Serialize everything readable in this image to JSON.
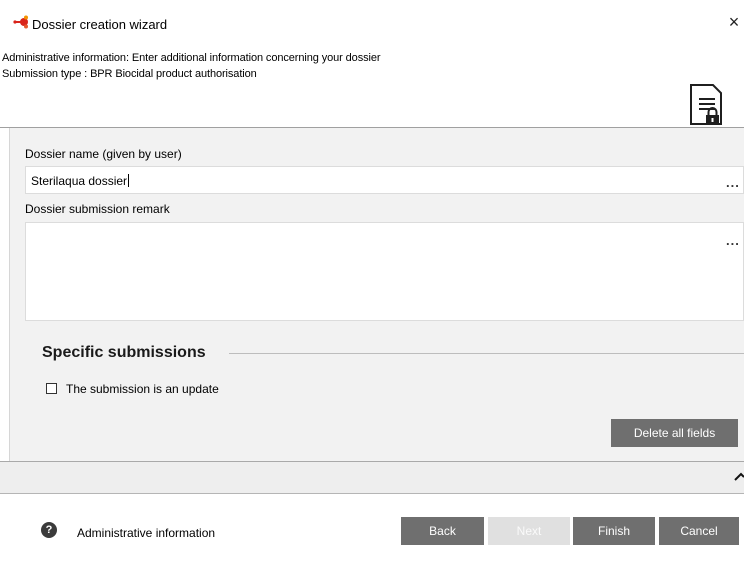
{
  "window": {
    "title": "Dossier creation wizard",
    "close_glyph": "×",
    "icon": "wizard-app-icon"
  },
  "header": {
    "line1": "Administrative information: Enter additional information concerning your dossier",
    "line2": "Submission type : BPR Biocidal product authorisation",
    "icon": "document-lock-icon"
  },
  "form": {
    "dossier_name_label": "Dossier name (given by user)",
    "dossier_name_value": "Sterilaqua dossier",
    "more_glyph": "...",
    "remark_label": "Dossier submission remark",
    "remark_value": ""
  },
  "specific": {
    "title": "Specific submissions",
    "update_checkbox_label": "The submission is an update",
    "update_checked": false,
    "delete_button": "Delete all fields"
  },
  "footer": {
    "help_glyph": "?",
    "step_label": "Administrative information",
    "buttons": {
      "back": "Back",
      "next": "Next",
      "finish": "Finish",
      "cancel": "Cancel"
    }
  },
  "colors": {
    "button_bg": "#6f6f6f",
    "button_disabled_bg": "#e0e0e0",
    "panel_bg": "#f2f2f2",
    "accent_red": "#d9241b",
    "accent_orange": "#f39200"
  }
}
